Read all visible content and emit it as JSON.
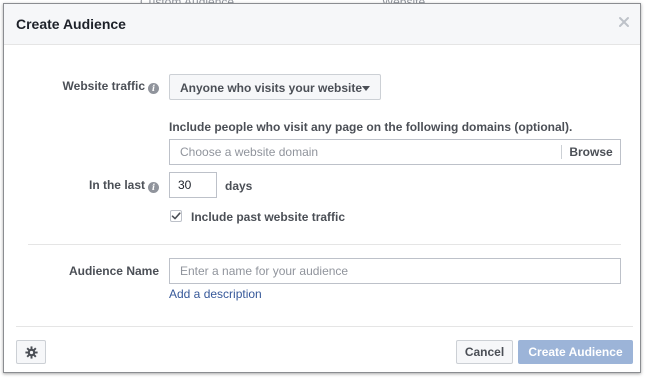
{
  "background": {
    "peek_left": "Custom Audience",
    "peek_right": "Website"
  },
  "dialog": {
    "title": "Create Audience",
    "close_icon": "close-icon"
  },
  "website_traffic": {
    "label": "Website traffic",
    "info_icon": "info-icon",
    "selected": "Anyone who visits your website"
  },
  "domains": {
    "hint": "Include people who visit any page on the following domains (optional).",
    "placeholder": "Choose a website domain",
    "browse_label": "Browse"
  },
  "in_the_last": {
    "label": "In the last",
    "value": "30",
    "unit": "days"
  },
  "past_traffic": {
    "label": "Include past website traffic",
    "checked": true
  },
  "audience_name": {
    "label": "Audience Name",
    "placeholder": "Enter a name for your audience",
    "add_description": "Add a description"
  },
  "footer": {
    "settings_icon": "gear-icon",
    "cancel_label": "Cancel",
    "create_label": "Create Audience"
  },
  "colors": {
    "primary_disabled": "#9cb4d8",
    "link": "#365899",
    "label_text": "#4b4f56"
  }
}
